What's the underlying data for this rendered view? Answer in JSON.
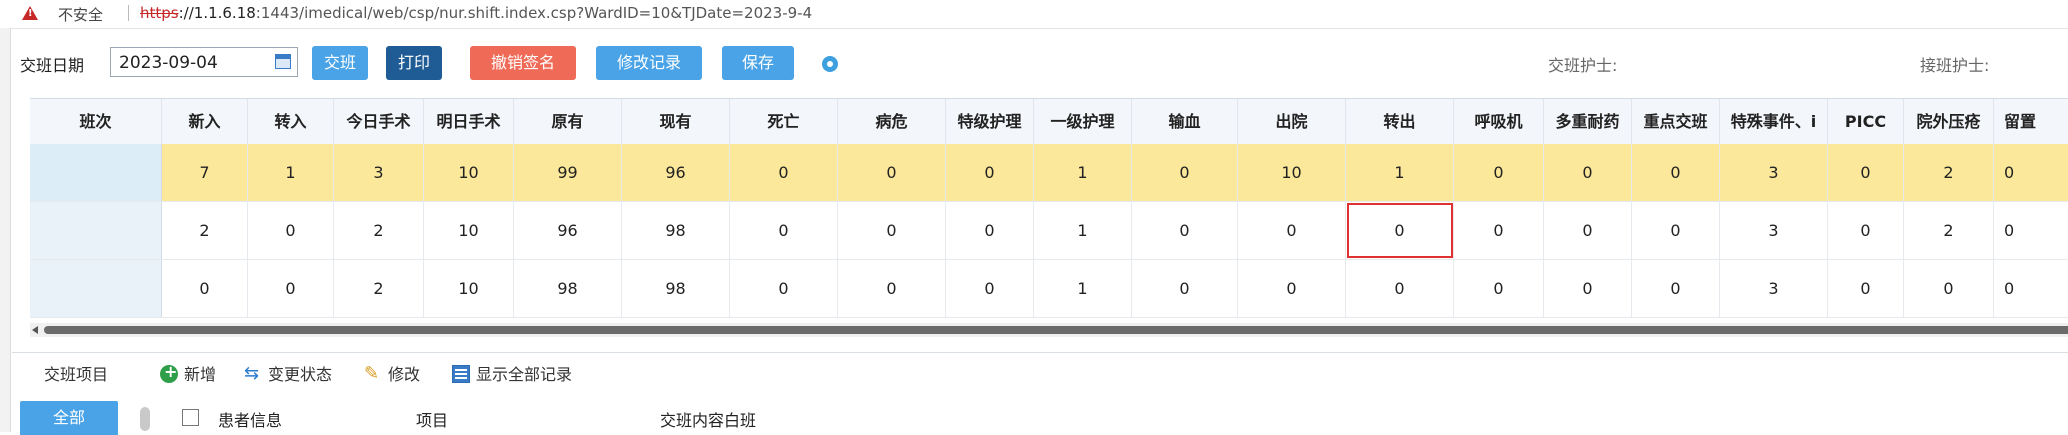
{
  "browser": {
    "insecure_label": "不安全",
    "url_protocol": "https",
    "url_host": "://1.1.6.18",
    "url_rest": ":1443/imedical/web/csp/nur.shift.index.csp?WardID=10&TJDate=2023-9-4"
  },
  "toolbar": {
    "date_label": "交班日期",
    "date_value": "2023-09-04",
    "buttons": [
      "交班",
      "打印",
      "撤销签名",
      "修改记录",
      "保存"
    ],
    "handover_nurse_label": "交班护士:",
    "receiver_nurse_label": "接班护士:"
  },
  "grid": {
    "columns": [
      "班次",
      "新入",
      "转入",
      "今日手术",
      "明日手术",
      "原有",
      "现有",
      "死亡",
      "病危",
      "特级护理",
      "一级护理",
      "输血",
      "出院",
      "转出",
      "呼吸机",
      "多重耐药",
      "重点交班",
      "特殊事件、i",
      "PICC",
      "院外压疮",
      "留置"
    ],
    "rows": [
      {
        "shift": "",
        "values": [
          "7",
          "1",
          "3",
          "10",
          "99",
          "96",
          "0",
          "0",
          "0",
          "1",
          "0",
          "10",
          "1",
          "0",
          "0",
          "0",
          "3",
          "0",
          "2",
          "0"
        ]
      },
      {
        "shift": "",
        "values": [
          "2",
          "0",
          "2",
          "10",
          "96",
          "98",
          "0",
          "0",
          "0",
          "1",
          "0",
          "0",
          "0",
          "0",
          "0",
          "0",
          "3",
          "0",
          "2",
          "0"
        ]
      },
      {
        "shift": "",
        "values": [
          "0",
          "0",
          "2",
          "10",
          "98",
          "98",
          "0",
          "0",
          "0",
          "1",
          "0",
          "0",
          "0",
          "0",
          "0",
          "0",
          "3",
          "0",
          "0",
          "0"
        ]
      }
    ]
  },
  "lower": {
    "section_title": "交班项目",
    "actions": [
      "新增",
      "变更状态",
      "修改",
      "显示全部记录"
    ],
    "tab_all": "全部",
    "table_headers": [
      "患者信息",
      "项目",
      "交班内容白班"
    ]
  },
  "colors": {
    "button_blue": "#4aa3e6",
    "button_dark": "#1f5c96",
    "button_red": "#ef6a57",
    "selected_row": "#fbe89a",
    "highlight_border": "#e03131"
  }
}
